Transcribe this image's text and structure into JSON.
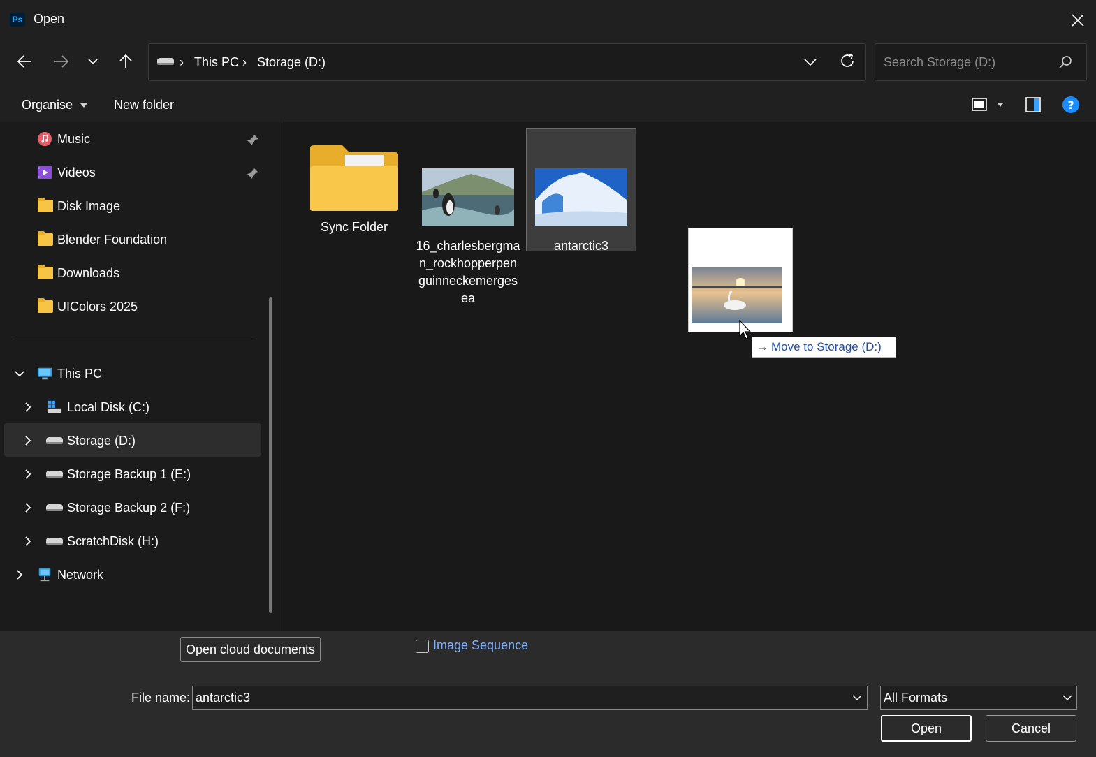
{
  "window": {
    "title": "Open",
    "app_icon": "photoshop-icon",
    "app_badge": "Ps"
  },
  "address": {
    "crumbs": [
      "This PC",
      "Storage (D:)"
    ],
    "drive_icon": "drive-icon"
  },
  "search": {
    "placeholder": "Search Storage (D:)"
  },
  "toolbar": {
    "organise_label": "Organise",
    "new_folder_label": "New folder"
  },
  "sidebar": {
    "quick": [
      {
        "label": "Music",
        "icon": "music-icon",
        "pinned": true
      },
      {
        "label": "Videos",
        "icon": "videos-icon",
        "pinned": true
      },
      {
        "label": "Disk Image",
        "icon": "folder-icon"
      },
      {
        "label": "Blender Foundation",
        "icon": "folder-icon"
      },
      {
        "label": "Downloads",
        "icon": "folder-icon"
      },
      {
        "label": "UIColors 2025",
        "icon": "folder-icon"
      }
    ],
    "this_pc": "This PC",
    "drives": [
      "Local Disk (C:)",
      "Storage (D:)",
      "Storage Backup 1 (E:)",
      "Storage Backup 2 (F:)",
      "ScratchDisk (H:)"
    ],
    "network": "Network",
    "selected": "Storage (D:)"
  },
  "files": [
    {
      "name": "Sync Folder",
      "type": "folder"
    },
    {
      "name": "16_charlesbergman_rockhopperpenguinneckemergesea",
      "type": "image"
    },
    {
      "name": "antarctic3",
      "type": "image",
      "selected": true
    }
  ],
  "drag": {
    "tooltip": "Move to Storage (D:)",
    "arrow": "→"
  },
  "bottom": {
    "cloud_button": "Open cloud documents",
    "image_sequence_label": "Image Sequence",
    "image_sequence_checked": false,
    "file_name_label": "File name:",
    "file_name_value": "antarctic3",
    "format_value": "All Formats",
    "open_label": "Open",
    "cancel_label": "Cancel"
  },
  "colors": {
    "background": "#1b1b1b",
    "accent_link": "#7fb0ff",
    "help": "#1a8cff",
    "folder": "#f7c445"
  }
}
